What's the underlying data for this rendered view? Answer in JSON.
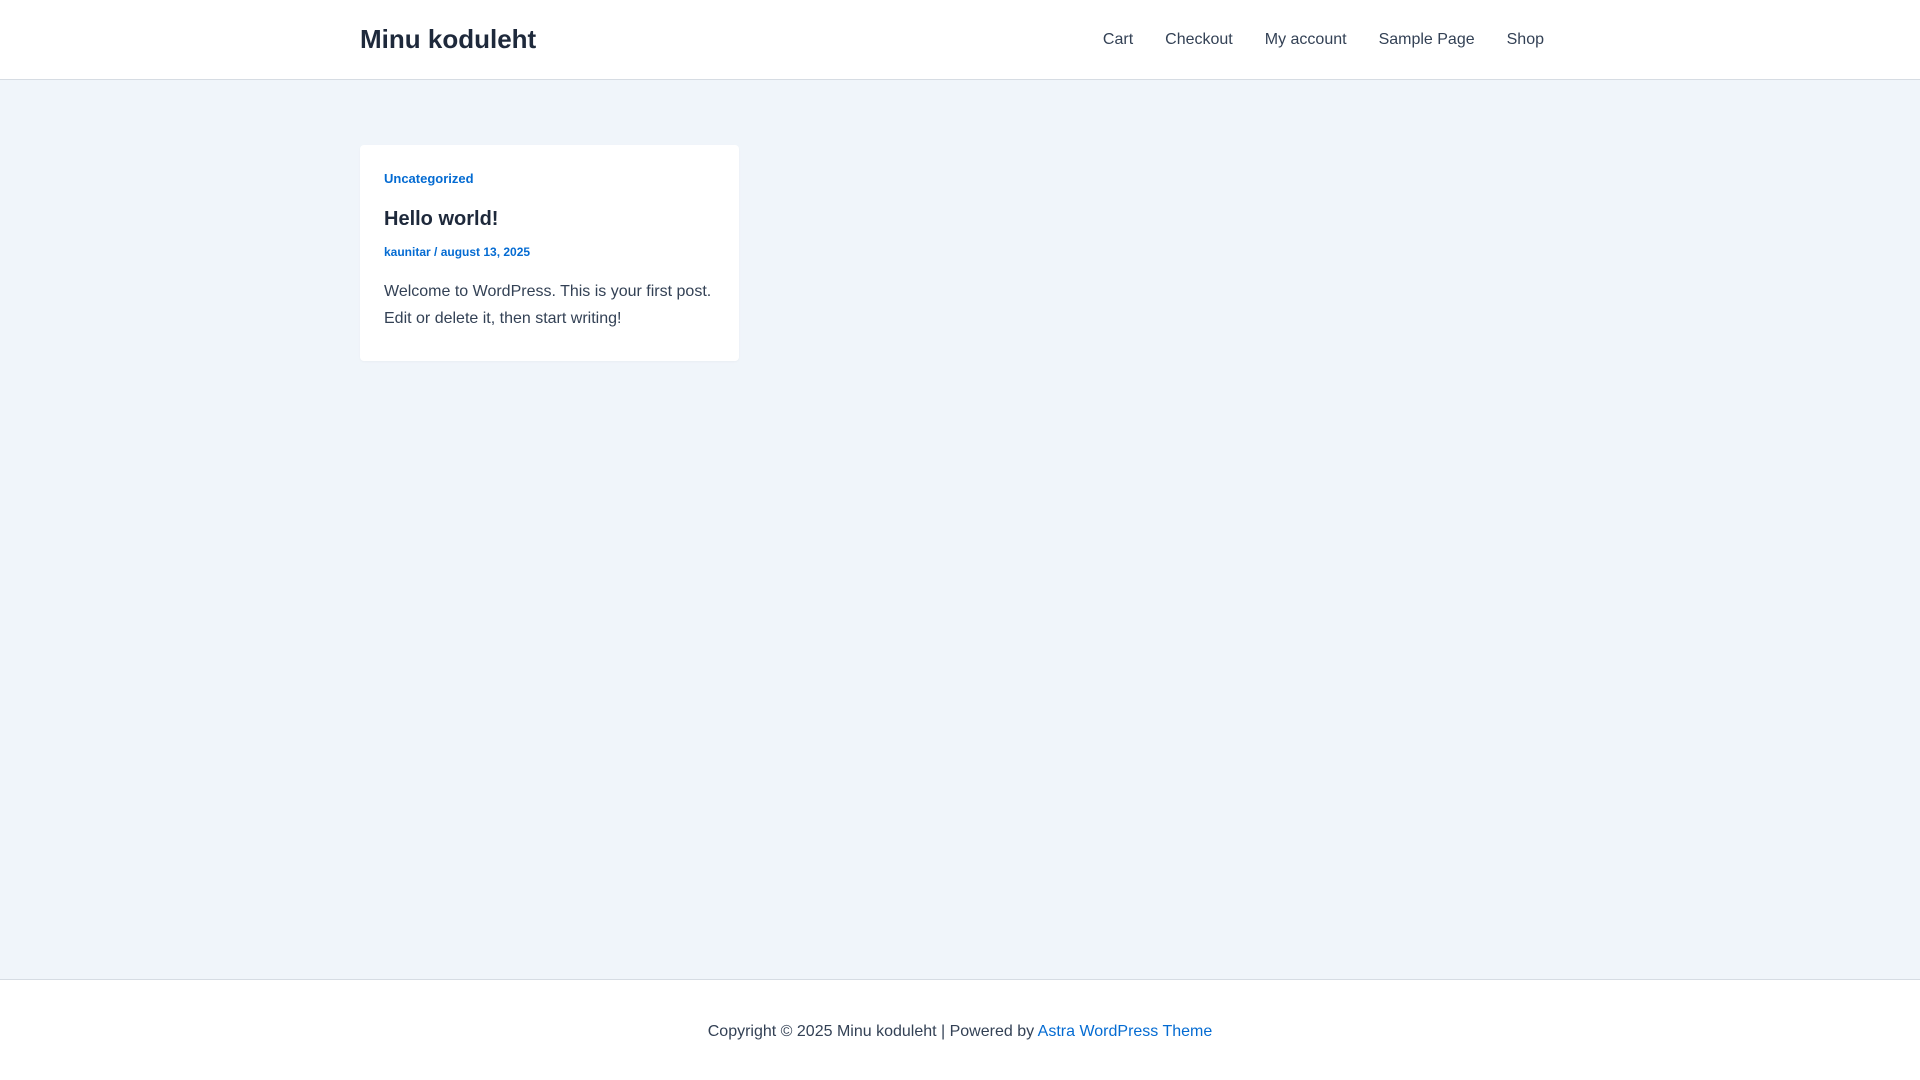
{
  "header": {
    "site_title": "Minu koduleht",
    "nav": [
      "Cart",
      "Checkout",
      "My account",
      "Sample Page",
      "Shop"
    ]
  },
  "post": {
    "category": "Uncategorized",
    "title": "Hello world!",
    "author": "kaunitar",
    "meta_separator": " / ",
    "date": "august 13, 2025",
    "excerpt": "Welcome to WordPress. This is your first post. Edit or delete it, then start writing!"
  },
  "footer": {
    "copyright": "Copyright © 2025 Minu koduleht | Powered by ",
    "theme_link": "Astra WordPress Theme"
  },
  "colors": {
    "accent": "#046bd2",
    "heading": "#1e293b",
    "text": "#334155",
    "background": "#f0f5fa"
  }
}
